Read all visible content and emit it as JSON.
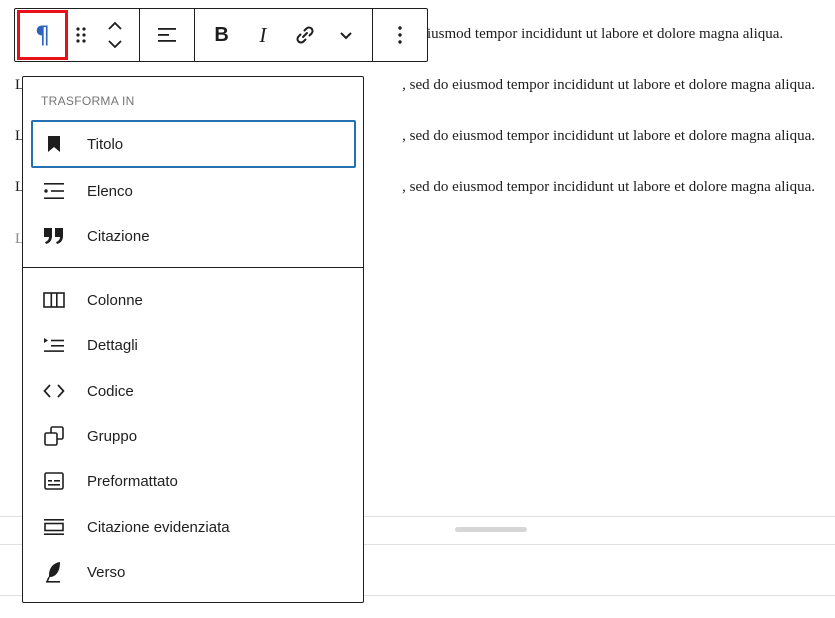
{
  "editor": {
    "first_paragraph_tail": "iusmod tempor incididunt ut labore et dolore magna aliqua.",
    "paragraph_tail": ", sed do eiusmod tempor incididunt ut labore et dolore magna aliqua.",
    "paragraph_start": "L",
    "last_paragraph_start": "L"
  },
  "toolbar": {
    "paragraph_icon": "paragraph-icon",
    "bold_label": "B",
    "italic_label": "I"
  },
  "transform_menu": {
    "heading": "Trasforma in",
    "items_top": [
      {
        "label": "Titolo",
        "icon": "bookmark-icon"
      },
      {
        "label": "Elenco",
        "icon": "list-icon"
      },
      {
        "label": "Citazione",
        "icon": "quote-icon"
      }
    ],
    "items_bottom": [
      {
        "label": "Colonne",
        "icon": "columns-icon"
      },
      {
        "label": "Dettagli",
        "icon": "details-icon"
      },
      {
        "label": "Codice",
        "icon": "code-icon"
      },
      {
        "label": "Gruppo",
        "icon": "group-icon"
      },
      {
        "label": "Preformattato",
        "icon": "preformatted-icon"
      },
      {
        "label": "Citazione evidenziata",
        "icon": "pullquote-icon"
      },
      {
        "label": "Verso",
        "icon": "feather-icon"
      }
    ]
  },
  "colors": {
    "accent": "#2371b1",
    "highlight_border": "#e8101a",
    "text": "#1e1e1e"
  }
}
